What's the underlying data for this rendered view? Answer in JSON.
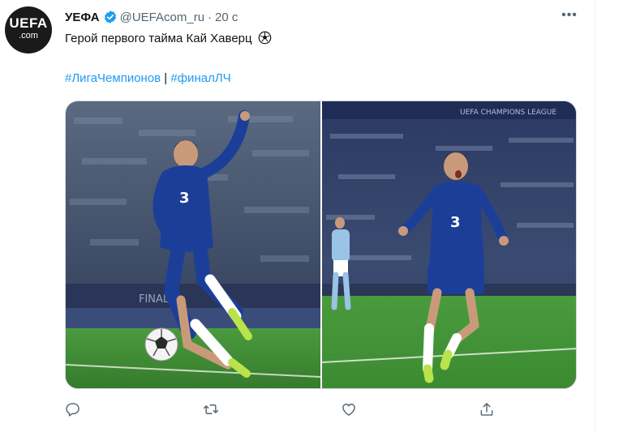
{
  "tweet": {
    "author_name": "УЕФА",
    "handle": "@UEFAcom_ru",
    "separator": "·",
    "time": "20 с",
    "text": "Герой первого тайма Кай Хаверц",
    "emoji": "soccer-ball-emoji",
    "hashtag_1": "#ЛигаЧемпионов",
    "hashtag_sep": " | ",
    "hashtag_2": "#финалЛЧ",
    "avatar_text_1": "UEFA",
    "avatar_text_2": ".com",
    "media": {
      "photos": [
        {
          "alt": "Kai Havertz controlling the ball, Chelsea blue kit"
        },
        {
          "alt": "Kai Havertz celebrating, Chelsea blue kit"
        }
      ]
    }
  },
  "actions": {
    "reply": "reply-icon",
    "retweet": "retweet-icon",
    "like": "heart-icon",
    "share": "share-icon"
  },
  "colors": {
    "link": "#1d9bf0",
    "secondary_text": "#536471",
    "verified": "#1d9bf0",
    "chelsea_blue": "#1b3f99",
    "pitch_green": "#3e8a34"
  }
}
